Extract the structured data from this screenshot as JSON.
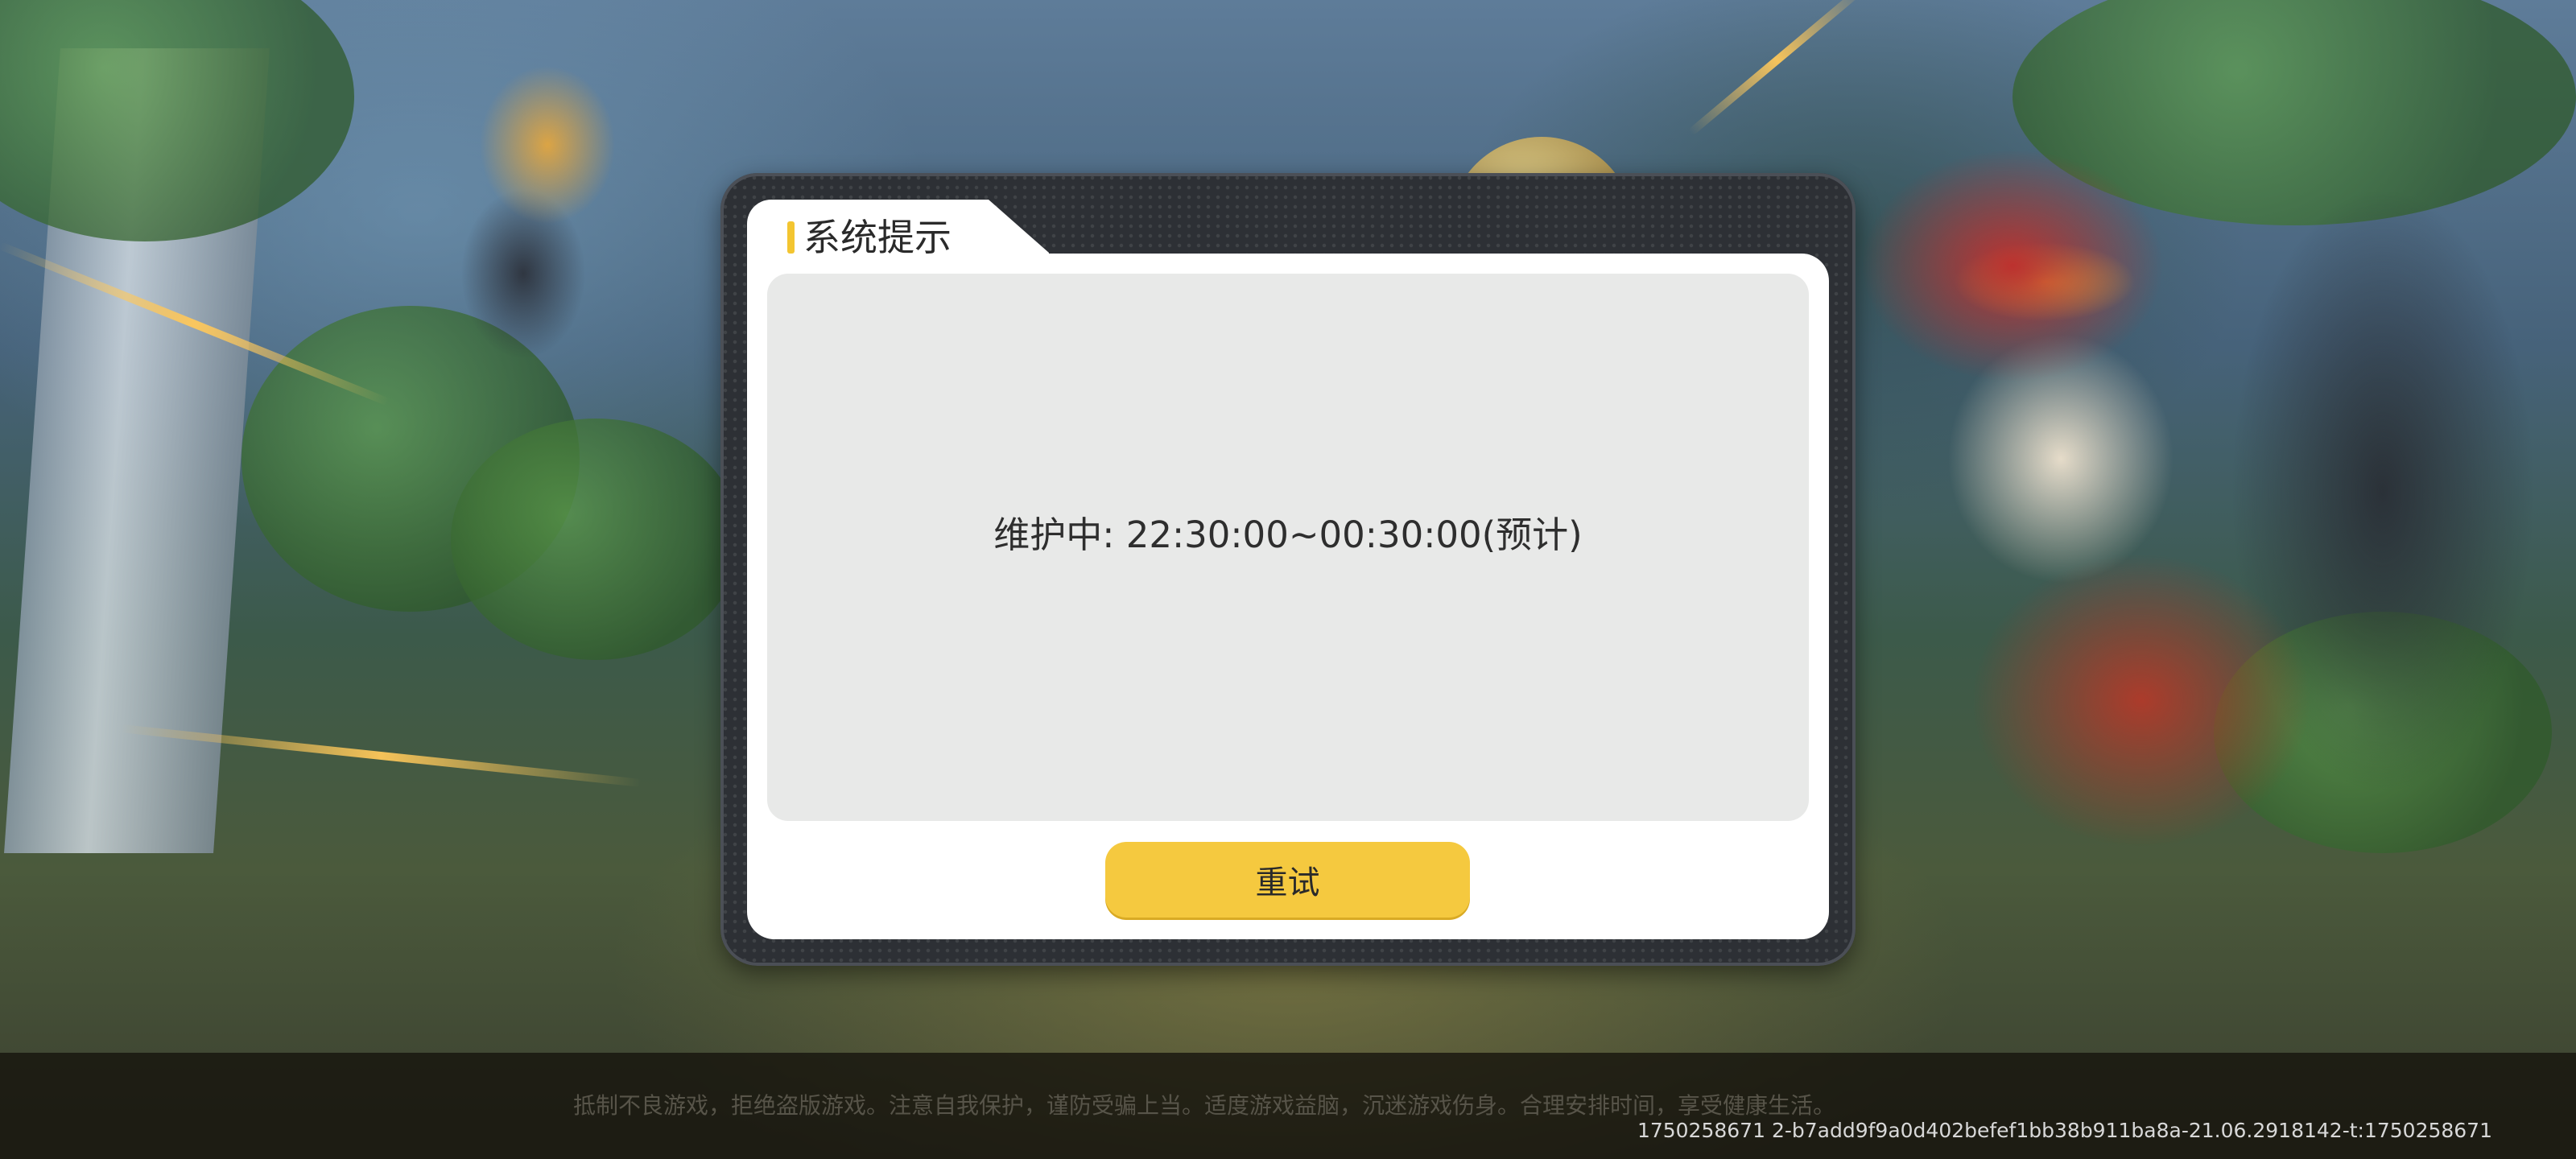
{
  "dialog": {
    "title": "系统提示",
    "message": "维护中: 22:30:00~00:30:00(预计)",
    "retry_label": "重试"
  },
  "footer": {
    "health_notice": "抵制不良游戏，拒绝盗版游戏。注意自我保护，谨防受骗上当。适度游戏益脑，沉迷游戏伤身。合理安排时间，享受健康生活。",
    "version_info": "1750258671  2-b7add9f9a0d402befef1bb38b911ba8a-21.06.2918142-t:1750258671"
  },
  "colors": {
    "accent_yellow": "#f5c93f",
    "dialog_frame": "#2d3035",
    "message_bg": "#e8e9e8"
  }
}
